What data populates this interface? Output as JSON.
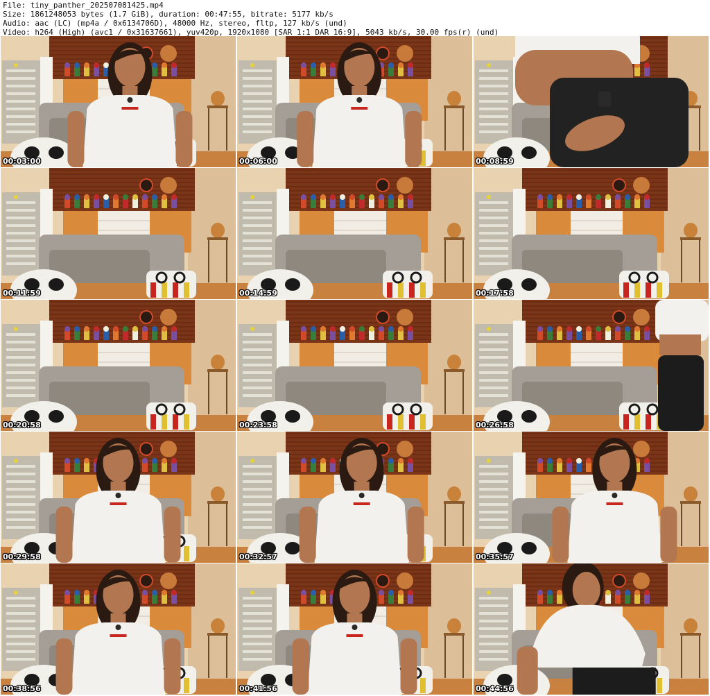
{
  "header": {
    "file": "File: tiny_panther_202507081425.mp4",
    "size": "Size: 1861248053 bytes (1.7 GiB), duration: 00:47:55, bitrate: 5177 kb/s",
    "audio": "Audio: aac (LC) (mp4a / 0x6134706D), 48000 Hz, stereo, fltp, 127 kb/s (und)",
    "video": "Video: h264 (High) (avc1 / 0x31637661), yuv420p, 1920x1080 [SAR 1:1 DAR 16:9], 5043 kb/s, 30.00 fps(r) (und)"
  },
  "colors": {
    "wall": "#e9d2b0",
    "cabinet": "#7a3418",
    "drawer": "#f2ede4",
    "sofa": "#a59e96",
    "shirt": "#f3f1ee",
    "skin": "#b27750",
    "hair": "#2a1a12"
  },
  "thumbnails": [
    {
      "time": "00:03:00",
      "scene": "person",
      "person": 0.55
    },
    {
      "time": "00:06:00",
      "scene": "person",
      "person": 0.52
    },
    {
      "time": "00:08:59",
      "scene": "closeup"
    },
    {
      "time": "00:11:59",
      "scene": "room"
    },
    {
      "time": "00:14:59",
      "scene": "room"
    },
    {
      "time": "00:17:58",
      "scene": "room"
    },
    {
      "time": "00:20:58",
      "scene": "room"
    },
    {
      "time": "00:23:58",
      "scene": "room"
    },
    {
      "time": "00:26:58",
      "scene": "side"
    },
    {
      "time": "00:29:58",
      "scene": "person",
      "person": 0.5
    },
    {
      "time": "00:32:57",
      "scene": "person",
      "person": 0.53
    },
    {
      "time": "00:35:57",
      "scene": "person",
      "person": 0.6
    },
    {
      "time": "00:38:56",
      "scene": "person",
      "person": 0.5
    },
    {
      "time": "00:41:56",
      "scene": "person",
      "person": 0.5
    },
    {
      "time": "00:44:56",
      "scene": "lean",
      "person": 0.48
    }
  ]
}
